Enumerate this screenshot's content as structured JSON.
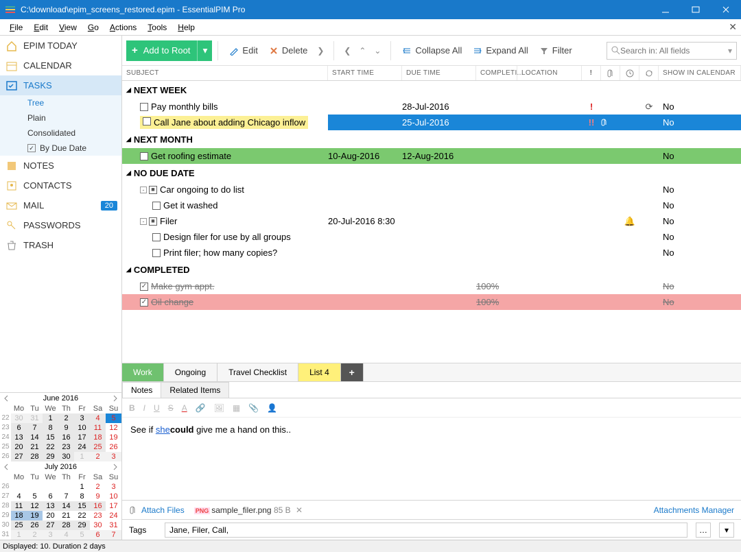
{
  "window": {
    "title": "C:\\download\\epim_screens_restored.epim - EssentialPIM Pro"
  },
  "menubar": [
    "File",
    "Edit",
    "View",
    "Go",
    "Actions",
    "Tools",
    "Help"
  ],
  "sidebar": {
    "items": [
      {
        "label": "EPIM TODAY",
        "icon": "home"
      },
      {
        "label": "CALENDAR",
        "icon": "calendar"
      },
      {
        "label": "TASKS",
        "icon": "tasks",
        "active": true
      },
      {
        "label": "NOTES",
        "icon": "notes"
      },
      {
        "label": "CONTACTS",
        "icon": "contacts"
      },
      {
        "label": "MAIL",
        "icon": "mail",
        "badge": "20"
      },
      {
        "label": "PASSWORDS",
        "icon": "key"
      },
      {
        "label": "TRASH",
        "icon": "trash"
      }
    ],
    "task_sub": [
      {
        "label": "Tree",
        "selected": true
      },
      {
        "label": "Plain"
      },
      {
        "label": "Consolidated"
      },
      {
        "label": "By Due Date",
        "checkbox": true,
        "checked": true
      }
    ]
  },
  "calendars": {
    "month1": {
      "title": "June  2016",
      "dow": [
        "Mo",
        "Tu",
        "We",
        "Th",
        "Fr",
        "Sa",
        "Su"
      ],
      "weeks": [
        {
          "wn": 22,
          "d": [
            {
              "n": 30,
              "o": 1
            },
            {
              "n": 31,
              "o": 1
            },
            {
              "n": 1,
              "s": 1
            },
            {
              "n": 2,
              "s": 1
            },
            {
              "n": 3,
              "s": 1
            },
            {
              "n": 4,
              "sa": 1,
              "s": 1
            },
            {
              "n": 5,
              "su": 1,
              "today": 1
            }
          ]
        },
        {
          "wn": 23,
          "d": [
            {
              "n": 6,
              "s": 1
            },
            {
              "n": 7,
              "s": 1
            },
            {
              "n": 8,
              "s": 1
            },
            {
              "n": 9,
              "s": 1
            },
            {
              "n": 10,
              "s": 1
            },
            {
              "n": 11,
              "sa": 1,
              "s": 1
            },
            {
              "n": 12,
              "su": 1
            }
          ]
        },
        {
          "wn": 24,
          "d": [
            {
              "n": 13,
              "s": 1
            },
            {
              "n": 14,
              "s": 1
            },
            {
              "n": 15,
              "s": 1
            },
            {
              "n": 16,
              "s": 1
            },
            {
              "n": 17,
              "s": 1
            },
            {
              "n": 18,
              "sa": 1,
              "s": 1
            },
            {
              "n": 19,
              "su": 1
            }
          ]
        },
        {
          "wn": 25,
          "d": [
            {
              "n": 20,
              "s": 1
            },
            {
              "n": 21,
              "s": 1
            },
            {
              "n": 22,
              "s": 1
            },
            {
              "n": 23,
              "s": 1
            },
            {
              "n": 24,
              "s": 1
            },
            {
              "n": 25,
              "sa": 1,
              "s": 1
            },
            {
              "n": 26,
              "su": 1
            }
          ]
        },
        {
          "wn": 26,
          "d": [
            {
              "n": 27,
              "s": 1
            },
            {
              "n": 28,
              "s": 1
            },
            {
              "n": 29,
              "s": 1
            },
            {
              "n": 30,
              "s": 1
            },
            {
              "n": 1,
              "o": 1
            },
            {
              "n": 2,
              "o": 1,
              "sa": 1
            },
            {
              "n": 3,
              "o": 1,
              "su": 1
            }
          ]
        }
      ]
    },
    "month2": {
      "title": "July  2016",
      "dow": [
        "Mo",
        "Tu",
        "We",
        "Th",
        "Fr",
        "Sa",
        "Su"
      ],
      "weeks": [
        {
          "wn": 26,
          "d": [
            {
              "n": ""
            },
            {
              "n": ""
            },
            {
              "n": ""
            },
            {
              "n": ""
            },
            {
              "n": 1
            },
            {
              "n": 2,
              "sa": 1
            },
            {
              "n": 3,
              "su": 1
            }
          ]
        },
        {
          "wn": 27,
          "d": [
            {
              "n": 4
            },
            {
              "n": 5
            },
            {
              "n": 6
            },
            {
              "n": 7
            },
            {
              "n": 8
            },
            {
              "n": 9,
              "sa": 1
            },
            {
              "n": 10,
              "su": 1
            }
          ]
        },
        {
          "wn": 28,
          "d": [
            {
              "n": 11,
              "s": 1
            },
            {
              "n": 12,
              "s": 1
            },
            {
              "n": 13,
              "s": 1
            },
            {
              "n": 14,
              "s": 1
            },
            {
              "n": 15,
              "s": 1
            },
            {
              "n": 16,
              "sa": 1,
              "s": 1
            },
            {
              "n": 17,
              "su": 1
            }
          ]
        },
        {
          "wn": 29,
          "d": [
            {
              "n": 18,
              "sel": 1
            },
            {
              "n": 19,
              "sel": 1
            },
            {
              "n": 20
            },
            {
              "n": 21
            },
            {
              "n": 22
            },
            {
              "n": 23,
              "sa": 1
            },
            {
              "n": 24,
              "su": 1
            }
          ]
        },
        {
          "wn": 30,
          "d": [
            {
              "n": 25,
              "s": 1
            },
            {
              "n": 26,
              "s": 1
            },
            {
              "n": 27,
              "s": 1
            },
            {
              "n": 28,
              "s": 1
            },
            {
              "n": 29,
              "s": 1
            },
            {
              "n": 30,
              "sa": 1
            },
            {
              "n": 31,
              "su": 1
            }
          ]
        },
        {
          "wn": 31,
          "d": [
            {
              "n": 1,
              "o": 1
            },
            {
              "n": 2,
              "o": 1
            },
            {
              "n": 3,
              "o": 1
            },
            {
              "n": 4,
              "o": 1
            },
            {
              "n": 5,
              "o": 1
            },
            {
              "n": 6,
              "o": 1,
              "sa": 1
            },
            {
              "n": 7,
              "o": 1,
              "su": 1
            }
          ]
        }
      ]
    }
  },
  "toolbar": {
    "add": "Add to Root",
    "edit": "Edit",
    "delete": "Delete",
    "collapse": "Collapse All",
    "expand": "Expand All",
    "filter": "Filter",
    "search_placeholder": "Search in: All fields"
  },
  "columns": {
    "subject": "SUBJECT",
    "start": "START TIME",
    "due": "DUE TIME",
    "completion": "COMPLETI...",
    "location": "LOCATION",
    "show": "SHOW IN CALENDAR"
  },
  "groups": [
    {
      "label": "NEXT WEEK",
      "rows": [
        {
          "subj": "Pay monthly bills",
          "due": "28-Jul-2016",
          "pri": "!",
          "repeat": true,
          "show": "No",
          "indent": 1,
          "chk": "empty"
        },
        {
          "subj": "Call Jane about adding Chicago inflow",
          "due": "25-Jul-2016",
          "pri": "!!",
          "att": true,
          "show": "No",
          "indent": 1,
          "chk": "empty",
          "highlight": "both"
        }
      ]
    },
    {
      "label": "NEXT MONTH",
      "rows": [
        {
          "subj": "Get roofing estimate",
          "start": "10-Aug-2016",
          "due": "12-Aug-2016",
          "show": "No",
          "indent": 1,
          "chk": "empty",
          "rowcolor": "green"
        }
      ]
    },
    {
      "label": "NO DUE DATE",
      "rows": [
        {
          "subj": "Car ongoing to do list",
          "show": "No",
          "indent": 1,
          "chk": "mixed",
          "toggle": "-"
        },
        {
          "subj": "Get it washed",
          "show": "No",
          "indent": 2,
          "chk": "empty"
        },
        {
          "subj": "Filer",
          "start": "20-Jul-2016 8:30",
          "show": "No",
          "indent": 1,
          "chk": "mixed",
          "bell": true,
          "toggle": "-"
        },
        {
          "subj": "Design filer for use by all groups",
          "show": "No",
          "indent": 2,
          "chk": "empty"
        },
        {
          "subj": "Print filer; how many copies?",
          "show": "No",
          "indent": 2,
          "chk": "empty"
        }
      ]
    },
    {
      "label": "COMPLETED",
      "rows": [
        {
          "subj": "Make gym appt.",
          "comp": "100%",
          "show": "No",
          "indent": 1,
          "chk": "done",
          "completed": true
        },
        {
          "subj": "Oil change",
          "comp": "100%",
          "show": "No",
          "indent": 1,
          "chk": "done",
          "completed": true,
          "rowcolor": "pink"
        }
      ]
    }
  ],
  "list_tabs": [
    {
      "label": "Work",
      "cls": "work"
    },
    {
      "label": "Ongoing"
    },
    {
      "label": "Travel Checklist"
    },
    {
      "label": "List 4",
      "cls": "l4"
    }
  ],
  "detail": {
    "sub_tabs": [
      "Notes",
      "Related Items"
    ],
    "note_pre": "See if ",
    "note_link": "she",
    "note_bold": "could",
    "note_post": " give me a hand on this..",
    "attach_label": "Attach Files",
    "attach_file": "sample_filer.png",
    "attach_size": "85 B",
    "attach_mgr": "Attachments Manager",
    "tags_label": "Tags",
    "tags_value": "Jane, Filer, Call,"
  },
  "status": "Displayed: 10. Duration 2 days"
}
